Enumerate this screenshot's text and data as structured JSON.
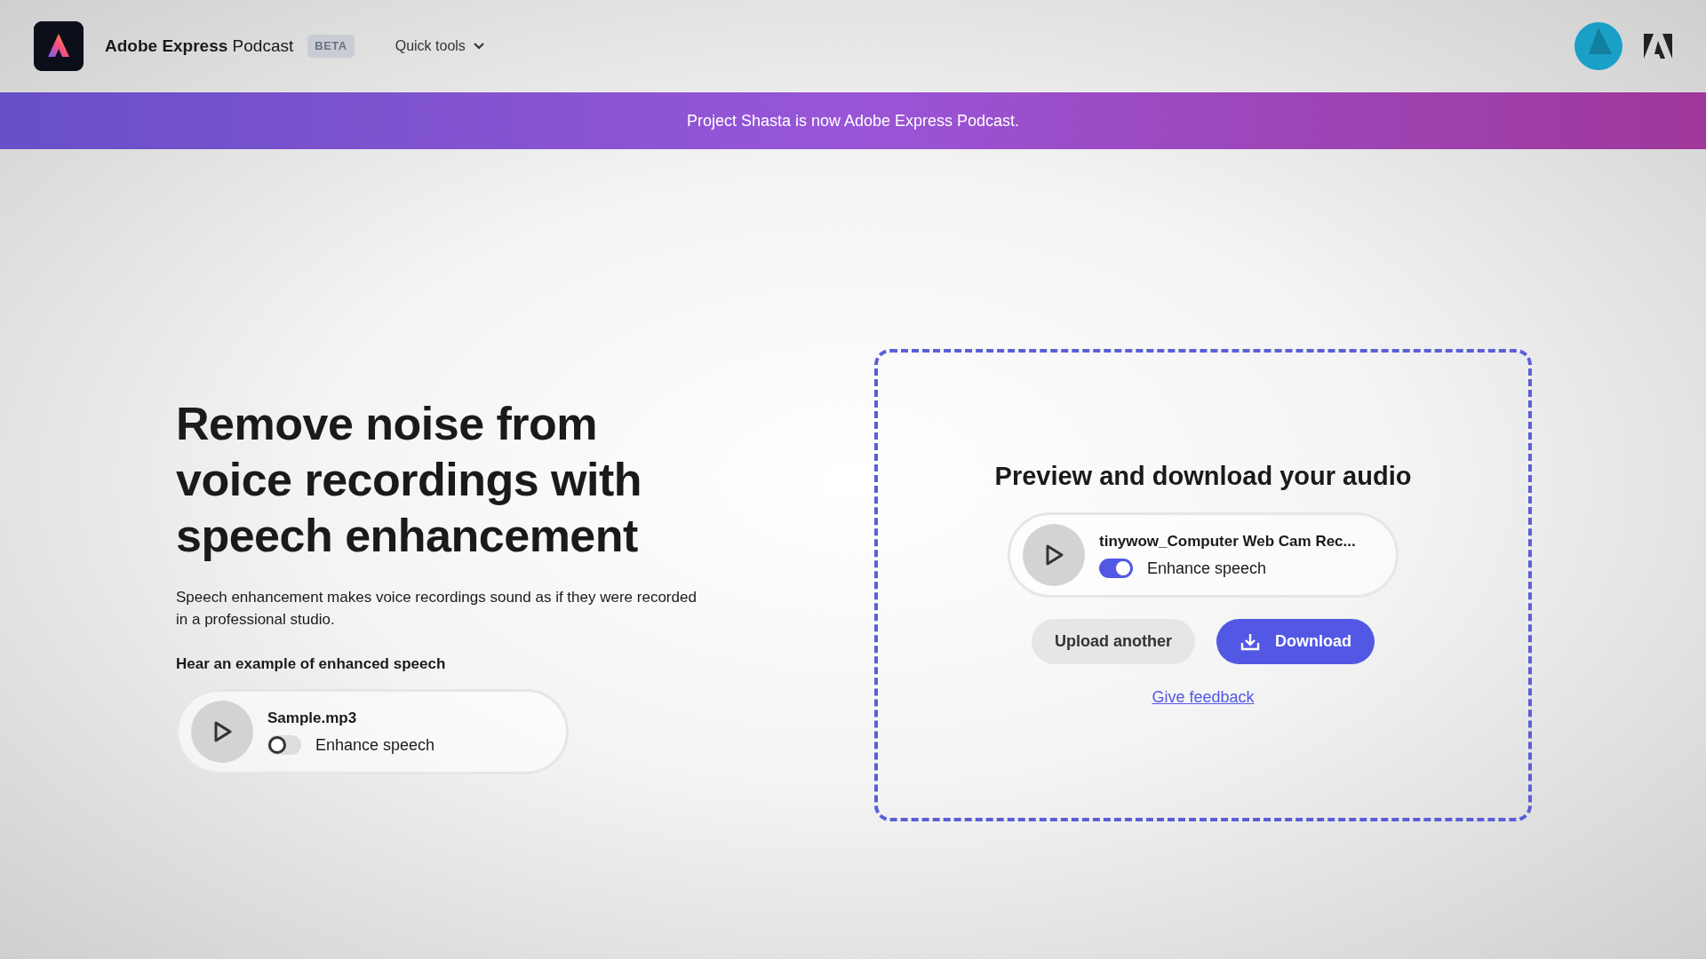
{
  "header": {
    "brand_bold": "Adobe Express",
    "brand_light": "Podcast",
    "badge": "BETA",
    "menu": {
      "label": "Quick tools",
      "expanded": false
    }
  },
  "banner": "Project Shasta is now Adobe Express Podcast.",
  "hero": {
    "title": "Remove noise from voice recordings with speech enhancement",
    "description": "Speech enhancement makes voice recordings sound as if they were recorded in a professional studio.",
    "example_label": "Hear an example of enhanced speech",
    "player": {
      "file": "Sample.mp3",
      "toggle_label": "Enhance speech",
      "on": false
    }
  },
  "result": {
    "title": "Preview and download your audio",
    "player": {
      "file": "tinywow_Computer Web Cam Rec...",
      "toggle_label": "Enhance speech",
      "on": true
    },
    "buttons": [
      {
        "kind": "secondary",
        "label": "Upload another"
      },
      {
        "kind": "primary",
        "label": "Download"
      }
    ],
    "feedback_link": "Give feedback"
  }
}
